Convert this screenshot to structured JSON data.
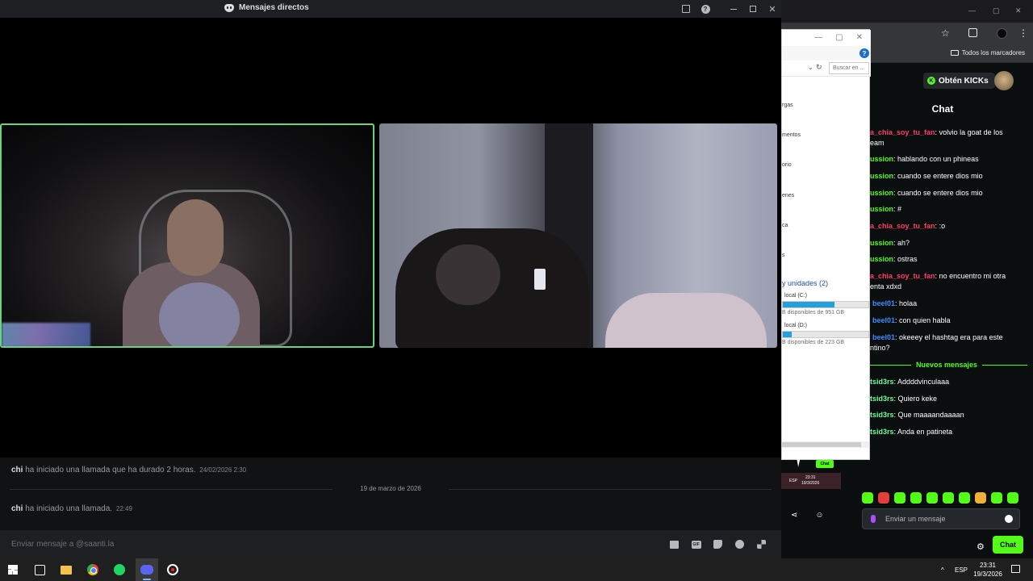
{
  "discord": {
    "window_title": "Mensajes directos",
    "messages": [
      {
        "user": "chi",
        "text": "ha iniciado una llamada que ha durado 2 horas.",
        "time": "24/02/2026 2:30"
      },
      {
        "user": "chi",
        "text": "ha iniciado una llamada.",
        "time": "22:49"
      }
    ],
    "date_divider": "19 de marzo de 2026",
    "input_placeholder": "Enviar mensaje a @saanti.la",
    "tile_highlight_color": "#6ad381"
  },
  "chrome": {
    "bookmarks_label": "Todos los marcadores"
  },
  "explorer": {
    "search_placeholder": "Buscar en ...",
    "nav_items": [
      "rgas",
      "mentos",
      "orio",
      "enes",
      "ca",
      "s"
    ],
    "section_title": "y unidades (2)",
    "drives": [
      {
        "label": "local (C:)",
        "free": "B disponibles de 951 GB",
        "used_fraction": 0.6
      },
      {
        "label": "local (D:)",
        "free": "B disponibles de 223 GB",
        "used_fraction": 0.1
      }
    ]
  },
  "kick": {
    "kicks_button": "Obtén KICKs",
    "chat_title": "Chat",
    "accent_color": "#53fc18",
    "chat": [
      {
        "user": "a_chia_soy_tu_fan",
        "color": "red",
        "text": " volvio la goat de los"
      },
      {
        "user": "",
        "color": "",
        "text": "eam"
      },
      {
        "user": "ussion",
        "color": "green",
        "text": " hablando con un phineas"
      },
      {
        "user": "ussion",
        "color": "green",
        "text": " cuando se entere dios mio"
      },
      {
        "user": "ussion",
        "color": "green",
        "text": " cuando se entere dios mio"
      },
      {
        "user": "ussion",
        "color": "green",
        "text": " #"
      },
      {
        "user": "a_chia_soy_tu_fan",
        "color": "red",
        "text": " :o"
      },
      {
        "user": "ussion",
        "color": "green",
        "text": " ah?"
      },
      {
        "user": "ussion",
        "color": "green",
        "text": " ostras"
      },
      {
        "user": "a_chia_soy_tu_fan",
        "color": "red",
        "text": " no encuentro mi otra"
      },
      {
        "user": "",
        "color": "",
        "text": "enta xdxd"
      },
      {
        "user": "beel01",
        "color": "blue",
        "text": " holaa"
      },
      {
        "user": "beel01",
        "color": "blue",
        "text": " con quien habla"
      },
      {
        "user": "beel01",
        "color": "blue",
        "text": " okeeey el hashtag era para este"
      },
      {
        "user": "",
        "color": "",
        "text": "ntino?"
      }
    ],
    "new_messages_label": "Nuevos mensajes",
    "chat_after": [
      {
        "user": "tsid3rs",
        "color": "lime",
        "text": " Addddvinculaaa"
      },
      {
        "user": "tsid3rs",
        "color": "lime",
        "text": " Quiero keke"
      },
      {
        "user": "tsid3rs",
        "color": "lime",
        "text": " Que maaaandaaaan"
      },
      {
        "user": "tsid3rs",
        "color": "lime",
        "text": " Anda en patineta"
      }
    ],
    "input_placeholder": "Enviar un mensaje",
    "chat_button": "Chat"
  },
  "mini_preview": {
    "chat_label": "Chat",
    "lang": "ESP",
    "time": "23:31",
    "date": "19/3/2026"
  },
  "taskbar": {
    "lang": "ESP",
    "time": "23:31",
    "date": "19/3/2026"
  }
}
